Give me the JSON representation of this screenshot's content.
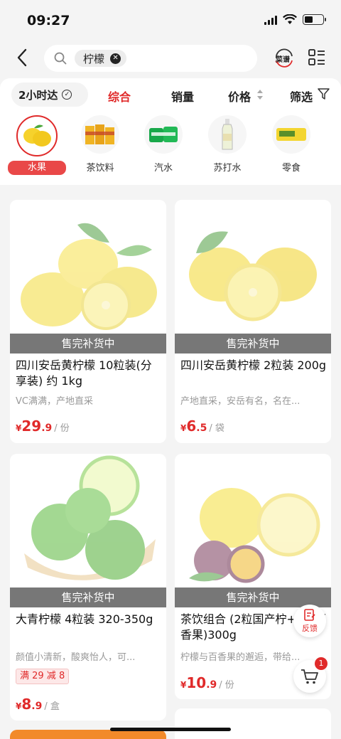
{
  "status": {
    "time": "09:27"
  },
  "search": {
    "query": "柠檬",
    "clear": "✕"
  },
  "recipe_label": "菜谱",
  "filters": {
    "delivery": "2小时达",
    "sorts": [
      "综合",
      "销量",
      "价格",
      "筛选"
    ]
  },
  "categories": [
    "水果",
    "茶饮料",
    "汽水",
    "苏打水",
    "零食"
  ],
  "products": [
    {
      "title": "四川安岳黄柠檬 10粒装(分享装) 约 1kg",
      "desc": "VC满满，产地直采",
      "price_int": "29",
      "price_dec": ".9",
      "unit": "/ 份",
      "status": "售完补货中"
    },
    {
      "title": "四川安岳黄柠檬 2粒装 200g",
      "desc": "产地直采，安岳有名，名在...",
      "price_int": "6",
      "price_dec": ".5",
      "unit": "/ 袋",
      "status": "售完补货中"
    },
    {
      "title": "大青柠檬 4粒装 320-350g",
      "desc": "颜值小清新，酸爽怡人，可...",
      "promo": "满 29 减 8",
      "price_int": "8",
      "price_dec": ".9",
      "unit": "/ 盒",
      "status": "售完补货中"
    },
    {
      "title": "茶饮组合 (2粒国产柠+2粒百香果)300g",
      "desc": "柠檬与百香果的邂逅，带给...",
      "price_int": "10",
      "price_dec": ".9",
      "unit": "/ 份",
      "status": "售完补货中"
    }
  ],
  "currency": "¥",
  "feedback_label": "反馈",
  "cart_count": "1",
  "colors": {
    "accent": "#e02a2a",
    "lemon": "#f6dc3c",
    "lime": "#5cbf3a"
  }
}
